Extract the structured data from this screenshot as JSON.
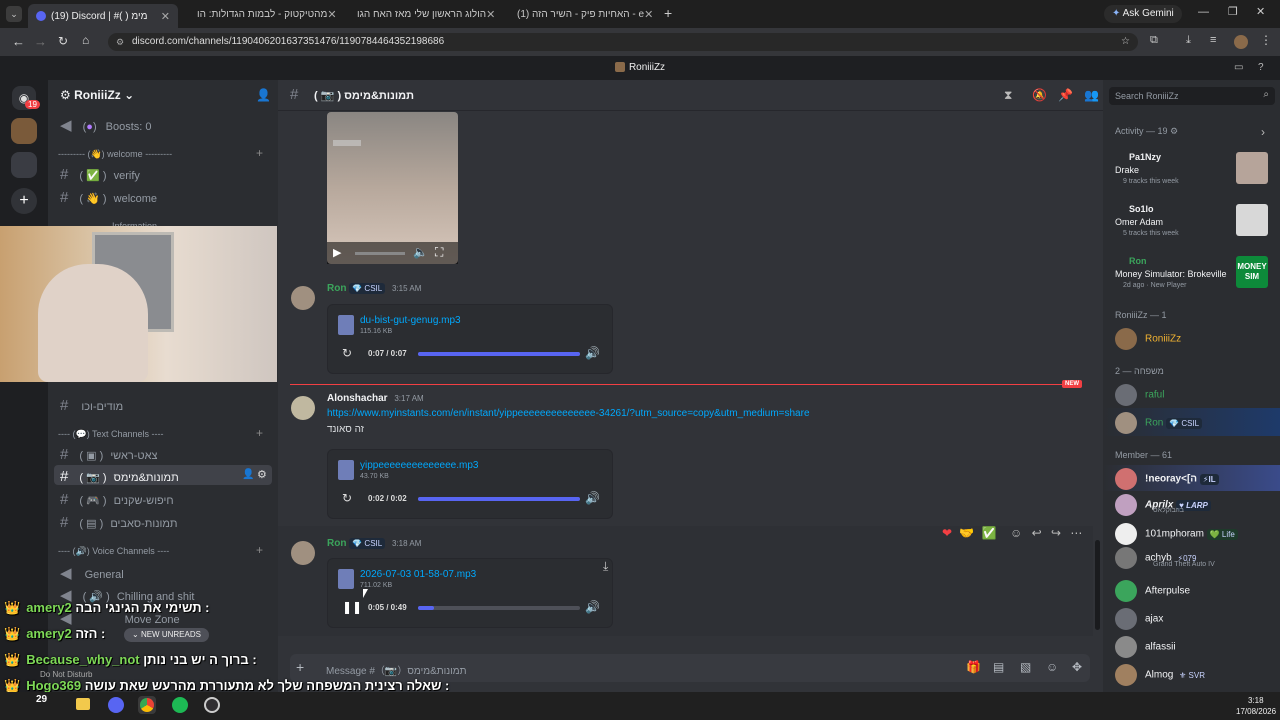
{
  "browser": {
    "tabs": [
      {
        "label": "(19) Discord | #( ) מימ",
        "active": true
      },
      {
        "label": "מהטיקטוק - לבמות הגדולות: הו",
        "active": false
      },
      {
        "label": "הולוג הראשון שלי מאז האח הגו",
        "active": false
      },
      {
        "label": "(1) האחיות פיק - השיר הזה - e",
        "active": false
      }
    ],
    "ask_gemini": "Ask Gemini",
    "url": "discord.com/channels/1190406201637351476/1190784464352198686"
  },
  "window_title": "RoniiiZz",
  "server": {
    "name": "RoniiiZz",
    "guild_badge": "19",
    "taskbar_badge": "29"
  },
  "channels": {
    "boosts": "Boosts: 0",
    "cat_welcome": "--------- (👋) welcome ---------",
    "verify": "verify",
    "welcome": "welcome",
    "information": "Information",
    "modim": "מודים-וכו",
    "cat_text": "---- (💬) Text Channels ----",
    "chat_main": "צאט-ראשי",
    "images_memes": "תמונות&מימס",
    "search_players": "חיפוש-שקנים",
    "images_sakas": "תמונות-סאבים",
    "cat_voice": "---- (🔊) Voice Channels ----",
    "general": "General",
    "chilling": "Chilling and shit",
    "move_zone": "Move Zone",
    "new_unreads": "NEW UNREADS",
    "user_status": "Do Not Disturb"
  },
  "chat": {
    "channel_title": "תמונות&מימס",
    "search_placeholder": "Search RoniiiZz",
    "msg1": {
      "author": "Ron",
      "tag": "CSIL",
      "time": "3:15 AM",
      "file": "du-bist-gut-genug.mp3",
      "size": "115.16 KB",
      "progress": "0:07 / 0:07",
      "fill": 1.0
    },
    "new_label": "NEW",
    "msg2": {
      "author": "Alonshachar",
      "time": "3:17 AM",
      "link": "https://www.myinstants.com/en/instant/yippeeeeeeeeeeeeee-34261/?utm_source=copy&utm_medium=share",
      "text": "זה סאונד",
      "file": "yippeeeeeeeeeeeeee.mp3",
      "size": "43.70 KB",
      "progress": "0:02 / 0:02",
      "fill": 1.0
    },
    "msg3": {
      "author": "Ron",
      "tag": "CSIL",
      "time": "3:18 AM",
      "file": "2026-07-03 01-58-07.mp3",
      "size": "711.02 KB",
      "progress": "0:05 / 0:49",
      "fill": 0.1
    },
    "composer_placeholder": "Message #（📷）תמונות&מימס"
  },
  "members": {
    "activity_header": "Activity — 19",
    "activities": [
      {
        "name": "Pa1Nzy",
        "title": "Drake",
        "sub": "9 tracks this week"
      },
      {
        "name": "So1lo",
        "title": "Omer Adam",
        "sub": "5 tracks this week"
      },
      {
        "name": "Ron",
        "title": "Money Simulator: Brokeville",
        "sub": "2d ago",
        "extra": "New Player",
        "art": "MONEY SIM"
      }
    ],
    "group1": "RoniiiZz — 1",
    "owner": "RoniiiZz",
    "group2": "משפחה — 2",
    "family": [
      {
        "name": "raful",
        "tag": ""
      },
      {
        "name": "Ron",
        "tag": "CSIL"
      }
    ],
    "group3": "Member — 61",
    "list": [
      {
        "name": "!neoray<[ה",
        "tag": "IL",
        "sub": ""
      },
      {
        "name": "Aprilx",
        "tag": "LARP",
        "sub": "בוזבוקלאס"
      },
      {
        "name": "101mphoram",
        "tag": "Life",
        "sub": ""
      },
      {
        "name": "achyb",
        "tag": "079",
        "sub": "Grand Theft Auto IV"
      },
      {
        "name": "Afterpulse",
        "tag": "",
        "sub": ""
      },
      {
        "name": "ajax",
        "tag": "",
        "sub": ""
      },
      {
        "name": "alfassii",
        "tag": "",
        "sub": ""
      },
      {
        "name": "Almog",
        "tag": "SVR",
        "sub": ""
      }
    ]
  },
  "stream_chat": [
    {
      "user": "amery2",
      "text": "תשימי את הגינגי הבה :"
    },
    {
      "user": "amery2",
      "text": "הזה :"
    },
    {
      "user": "Because_why_not",
      "text": "ברוך ה יש בני נותן :"
    },
    {
      "user": "Hogo369",
      "text": "שאלה רצינית המשפחה שלך לא מתעוררת מהרעש שאת עושה :"
    }
  ],
  "clock": {
    "time": "3:18",
    "date": "17/08/2026"
  }
}
